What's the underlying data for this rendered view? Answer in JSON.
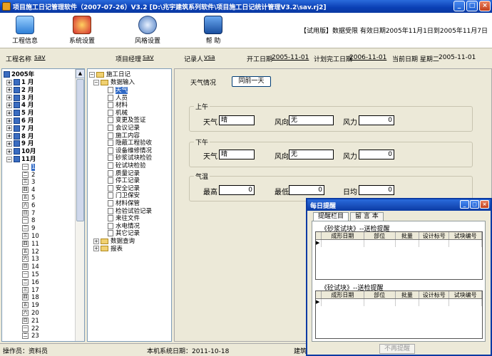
{
  "window": {
    "title": "项目施工日记管理软件（2007-07-26）V3.2   [D:\\兆宇建筑系列软件\\项目施工日记统计管理V3.2\\sav.rj2]"
  },
  "toolbar": {
    "items": [
      {
        "label": "工程信息"
      },
      {
        "label": "系统设置"
      },
      {
        "label": "风格设置"
      },
      {
        "label": "帮  助"
      }
    ],
    "trial_text": "【试用版】数据受限    有效日期2005年11月1日到2005年11月7日"
  },
  "info": {
    "project_label": "工程名称",
    "project_value": "sav",
    "manager_label": "项目经理",
    "manager_value": "sav",
    "recorder_label": "记录人",
    "recorder_value": "vsa",
    "start_label": "开工日期",
    "start_value": "2005-11-01",
    "plan_end_label": "计划完工日期",
    "plan_end_value": "2006-11-01",
    "current_label": "当前日期 星期二",
    "current_value": "2005-11-01"
  },
  "calendar": {
    "year": "2005年",
    "months": [
      "1 月",
      "2 月",
      "3 月",
      "4 月",
      "5 月",
      "6 月",
      "7 月",
      "8 月",
      "9 月",
      "10月",
      "11月"
    ],
    "days": [
      "1",
      "2",
      "3",
      "4",
      "5",
      "6",
      "7",
      "8",
      "9",
      "10",
      "11",
      "12",
      "13",
      "14",
      "15",
      "16",
      "17",
      "18",
      "19",
      "20",
      "21",
      "22",
      "23"
    ],
    "day_glyphs": [
      "一",
      "二",
      "三",
      "四",
      "五",
      "六",
      "日",
      "一",
      "二",
      "三",
      "四",
      "五",
      "六",
      "日",
      "一",
      "二",
      "三",
      "四",
      "五",
      "六",
      "日",
      "一",
      "二"
    ]
  },
  "diary_tree": {
    "root": "施工日记",
    "group": "数据输入",
    "items": [
      "天气",
      "人员",
      "材料",
      "机械",
      "变更及签证",
      "会议记录",
      "施工内容",
      "隐蔽工程验收",
      "设备维修情况",
      "砂浆试块检验",
      "砼试块检验",
      "质量记录",
      "停工记录",
      "安全记录",
      "门卫保安",
      "材料保管",
      "检验试验记录",
      "来往文件",
      "水电情况",
      "其它记录"
    ],
    "tail": [
      "数据查询",
      "报表"
    ]
  },
  "weather": {
    "label": "天气情况",
    "same_btn": "同前一天",
    "morning": {
      "legend": "上午",
      "weather_label": "天气",
      "weather_value": "晴",
      "wind_dir_label": "风向",
      "wind_dir_value": "无",
      "wind_force_label": "风力",
      "wind_force_value": "0"
    },
    "afternoon": {
      "legend": "下午",
      "weather_label": "天气",
      "weather_value": "晴",
      "wind_dir_label": "风向",
      "wind_dir_value": "无",
      "wind_force_label": "风力",
      "wind_force_value": "0"
    },
    "temp": {
      "legend": "气温",
      "high_label": "最高",
      "high_value": "0",
      "low_label": "最低",
      "low_value": "0",
      "avg_label": "日均",
      "avg_value": "0"
    }
  },
  "status": {
    "operator": "操作员：资料员",
    "sys_date": "本机系统日期：2011-10-18",
    "tail": "建筑"
  },
  "popup": {
    "title": "每日提醒",
    "tabs": [
      "提醒栏目",
      "留 言 本"
    ],
    "sec1_title": "《砂浆试块》--送检提醒",
    "sec2_title": "《砼试块》--送检提醒",
    "cols": [
      "成形日期",
      "部位",
      "批量",
      "设计标号",
      "试块编号"
    ],
    "button": "不再提醒"
  }
}
